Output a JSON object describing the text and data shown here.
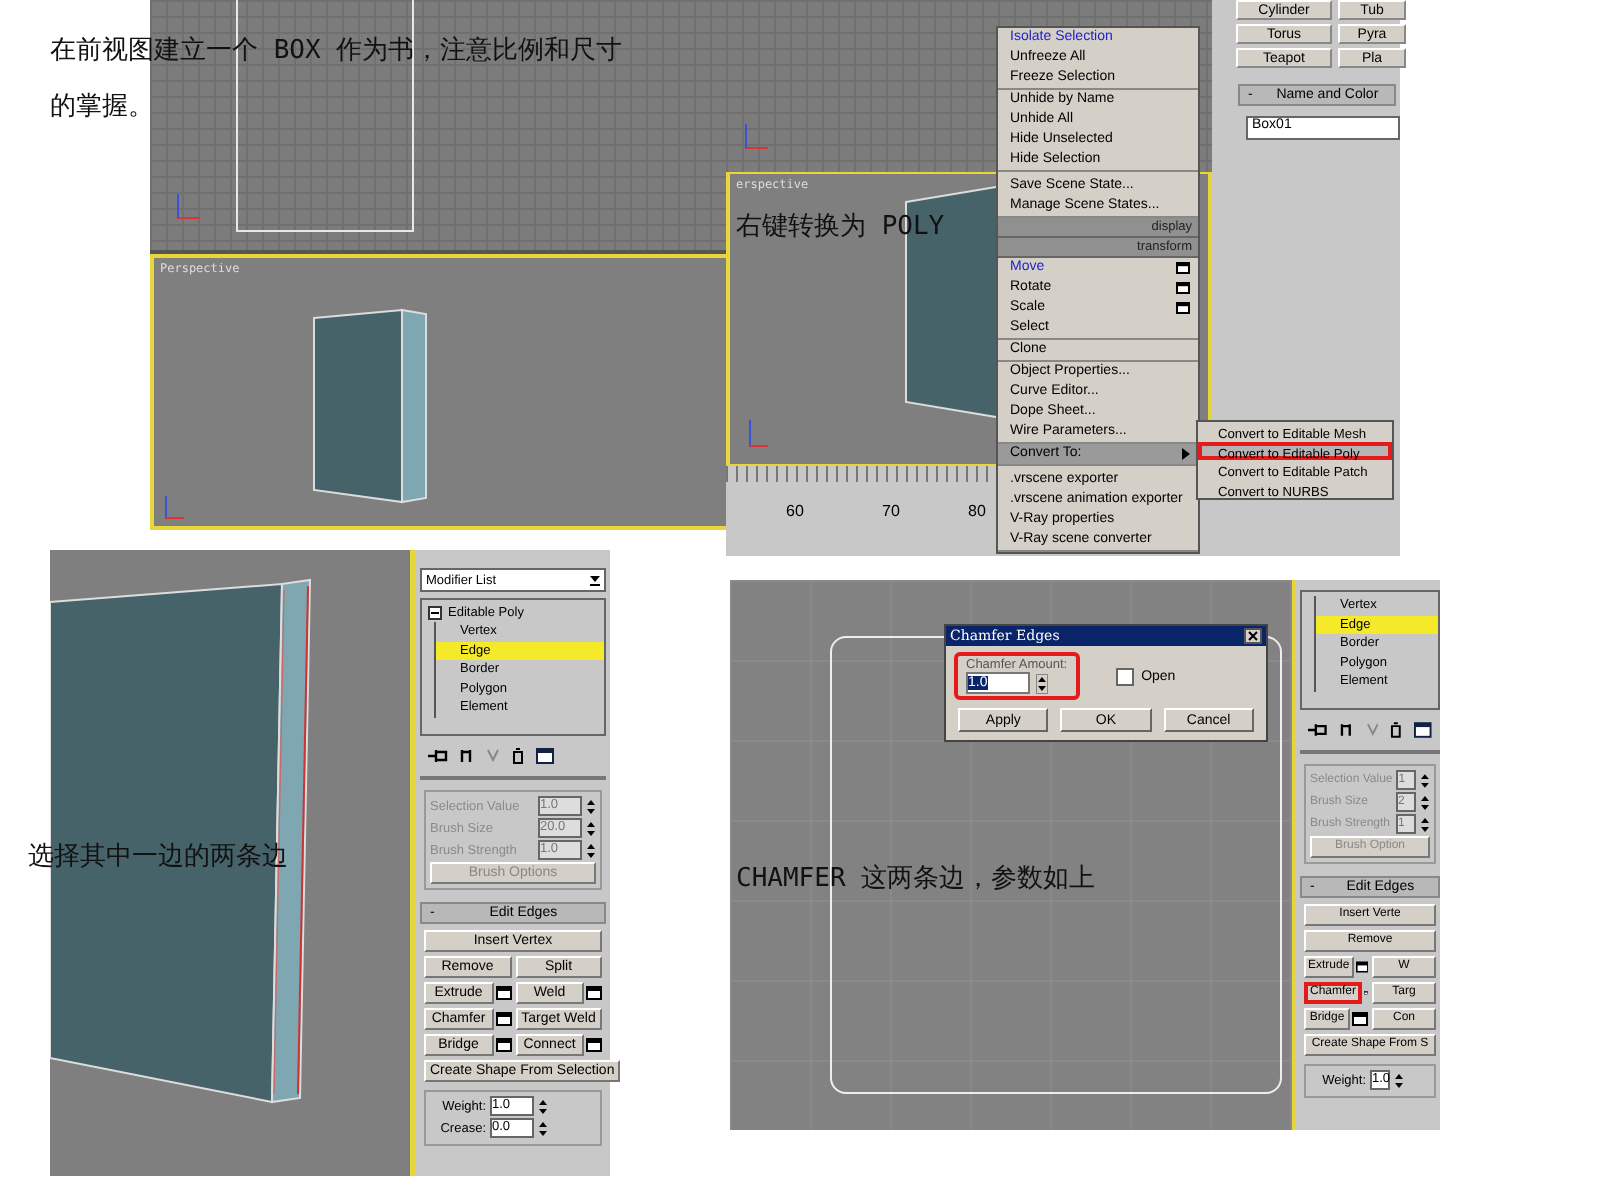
{
  "step1": {
    "caption": "在前视图建立一个 BOX 作为书，注意比例和尺寸的掌握。",
    "front_viewport": {
      "active": false
    },
    "perspective_viewport": {
      "label": "Perspective",
      "active": true
    }
  },
  "step2": {
    "caption": "右键转换为 POLY",
    "perspective_viewport": {
      "label": "erspective",
      "active": true
    },
    "ruler_ticks": [
      "60",
      "70",
      "80"
    ],
    "create_buttons": [
      "Cylinder",
      "Tub",
      "Torus",
      "Pyra",
      "Teapot",
      "Pla"
    ],
    "rollout": {
      "toggle": "-",
      "title": "Name and Color"
    },
    "name_field": {
      "value": "Box01"
    },
    "quad_menu": {
      "quadrants": [
        {
          "kind": "header-below",
          "header": "display",
          "groups": [
            [
              {
                "label": "Isolate Selection",
                "kind": "plain",
                "accent": true
              },
              {
                "label": "Unfreeze All",
                "kind": "plain",
                "accent": false
              },
              {
                "label": "Freeze Selection",
                "kind": "plain",
                "accent": false
              }
            ],
            [
              {
                "label": "Unhide by Name",
                "kind": "plain",
                "accent": false
              },
              {
                "label": "Unhide All",
                "kind": "plain",
                "accent": false
              },
              {
                "label": "Hide Unselected",
                "kind": "plain",
                "accent": false
              },
              {
                "label": "Hide Selection",
                "kind": "plain",
                "accent": false
              }
            ],
            [
              {
                "label": "Save Scene State...",
                "kind": "plain",
                "accent": false
              },
              {
                "label": "Manage Scene States...",
                "kind": "plain",
                "accent": false
              }
            ]
          ]
        },
        {
          "kind": "header-above",
          "header": "transform",
          "groups": [
            [
              {
                "label": "Move",
                "kind": "option",
                "accent": true
              },
              {
                "label": "Rotate",
                "kind": "option",
                "accent": false
              },
              {
                "label": "Scale",
                "kind": "option",
                "accent": false
              },
              {
                "label": "Select",
                "kind": "plain",
                "accent": false
              }
            ],
            [
              {
                "label": "Clone",
                "kind": "plain",
                "accent": false
              }
            ],
            [
              {
                "label": "Object Properties...",
                "kind": "plain",
                "accent": false
              },
              {
                "label": "Curve Editor...",
                "kind": "plain",
                "accent": false
              },
              {
                "label": "Dope Sheet...",
                "kind": "plain",
                "accent": false
              },
              {
                "label": "Wire Parameters...",
                "kind": "plain",
                "accent": false
              }
            ],
            [
              {
                "label": "Convert To:",
                "kind": "submenu",
                "accent": false
              }
            ],
            [
              {
                "label": ".vrscene exporter",
                "kind": "plain",
                "accent": false
              },
              {
                "label": ".vrscene animation exporter",
                "kind": "plain",
                "accent": false
              },
              {
                "label": "V-Ray properties",
                "kind": "plain",
                "accent": false
              },
              {
                "label": "V-Ray scene converter",
                "kind": "plain",
                "accent": false
              }
            ]
          ]
        }
      ]
    },
    "submenu": [
      {
        "label": "Convert to Editable Mesh",
        "selected": false,
        "marked": false
      },
      {
        "label": "Convert to Editable Poly",
        "selected": true,
        "marked": true
      },
      {
        "label": "Convert to Editable Patch",
        "selected": false,
        "marked": false
      },
      {
        "label": "Convert to NURBS",
        "selected": false,
        "marked": false
      }
    ]
  },
  "step3": {
    "caption": "选择其中一边的两条边",
    "panel": {
      "modifier_list": "Modifier List",
      "stack": {
        "label": "Editable Poly",
        "expanded": true,
        "children": [
          {
            "label": "Vertex",
            "selected": false
          },
          {
            "label": "Edge",
            "selected": true
          },
          {
            "label": "Border",
            "selected": false
          },
          {
            "label": "Polygon",
            "selected": false
          },
          {
            "label": "Element",
            "selected": false
          }
        ]
      },
      "params": [
        {
          "label": "Selection Value",
          "value": "1.0",
          "disabled": true
        },
        {
          "label": "Brush Size",
          "value": "20.0",
          "disabled": true
        },
        {
          "label": "Brush Strength",
          "value": "1.0",
          "disabled": true
        }
      ],
      "brush_button": "Brush Options",
      "rollout": {
        "toggle": "-",
        "title": "Edit Edges"
      },
      "button_rows": [
        [
          {
            "label": "Insert Vertex",
            "settings": false,
            "marked": false
          }
        ],
        [
          {
            "label": "Remove",
            "settings": false,
            "marked": false
          },
          {
            "label": "Split",
            "settings": false,
            "marked": false
          }
        ],
        [
          {
            "label": "Extrude",
            "settings": true,
            "marked": false
          },
          {
            "label": "Weld",
            "settings": true,
            "marked": false
          }
        ],
        [
          {
            "label": "Chamfer",
            "settings": true,
            "marked": false
          },
          {
            "label": "Target Weld",
            "settings": false,
            "marked": false
          }
        ],
        [
          {
            "label": "Bridge",
            "settings": true,
            "marked": false
          },
          {
            "label": "Connect",
            "settings": true,
            "marked": false
          }
        ],
        [
          {
            "label": "Create Shape From Selection",
            "settings": false,
            "marked": false
          }
        ]
      ],
      "fields": [
        {
          "label": "Weight:",
          "value": "1.0"
        },
        {
          "label": "Crease:",
          "value": "0.0"
        }
      ]
    }
  },
  "step4": {
    "caption": "CHAMFER 这两条边，参数如上",
    "dialog": {
      "title": "Chamfer Edges",
      "amount_label": "Chamfer Amount:",
      "amount_value": "1.0",
      "amount_marked": true,
      "open_label": "Open",
      "open_checked": false,
      "buttons": [
        "Apply",
        "OK",
        "Cancel"
      ]
    },
    "panel": {
      "stack": {
        "children": [
          {
            "label": "Vertex",
            "selected": false
          },
          {
            "label": "Edge",
            "selected": true
          },
          {
            "label": "Border",
            "selected": false
          },
          {
            "label": "Polygon",
            "selected": false
          },
          {
            "label": "Element",
            "selected": false
          }
        ]
      },
      "params": [
        {
          "label": "Selection Value",
          "value": "1",
          "disabled": true
        },
        {
          "label": "Brush Size",
          "value": "2",
          "disabled": true
        },
        {
          "label": "Brush Strength",
          "value": "1",
          "disabled": true
        }
      ],
      "brush_button": "Brush Option",
      "rollout": {
        "toggle": "-",
        "title": "Edit Edges"
      },
      "button_rows": [
        [
          {
            "label": "Insert Verte",
            "settings": false,
            "marked": false
          }
        ],
        [
          {
            "label": "Remove",
            "settings": false,
            "marked": false
          }
        ],
        [
          {
            "label": "Extrude",
            "settings": true,
            "marked": false
          },
          {
            "label": "W",
            "settings": false,
            "marked": false
          }
        ],
        [
          {
            "label": "Chamfer",
            "settings": true,
            "marked": true
          },
          {
            "label": "Targ",
            "settings": false,
            "marked": false
          }
        ],
        [
          {
            "label": "Bridge",
            "settings": true,
            "marked": false
          },
          {
            "label": "Con",
            "settings": false,
            "marked": false
          }
        ],
        [
          {
            "label": "Create Shape From S",
            "settings": false,
            "marked": false
          }
        ]
      ],
      "fields": [
        {
          "label": "Weight:",
          "value": "1.0"
        }
      ]
    }
  }
}
